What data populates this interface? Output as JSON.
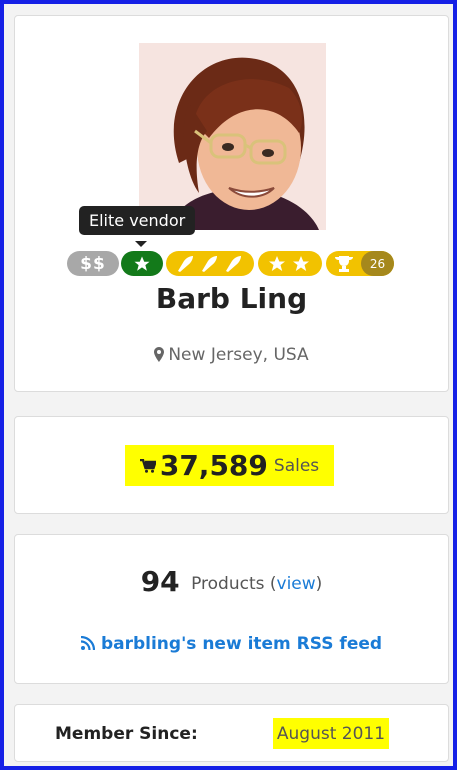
{
  "profile": {
    "tooltip": "Elite vendor",
    "badges": {
      "dollar": "$$",
      "trophy_count": "26"
    },
    "name": "Barb Ling",
    "location": "New Jersey, USA"
  },
  "sales": {
    "count": "37,589",
    "label": "Sales"
  },
  "products": {
    "count": "94",
    "label": "Products",
    "open_paren": "(",
    "view_link": "view",
    "close_paren": ")"
  },
  "rss": {
    "label": "barbling's new item RSS feed"
  },
  "member": {
    "label": "Member Since:",
    "value": "August 2011"
  },
  "colors": {
    "frame": "#1520e6",
    "highlight": "#ffff00",
    "link": "#1a7bd6",
    "elite_badge": "#137a1a",
    "gold_badge": "#f2c200"
  }
}
